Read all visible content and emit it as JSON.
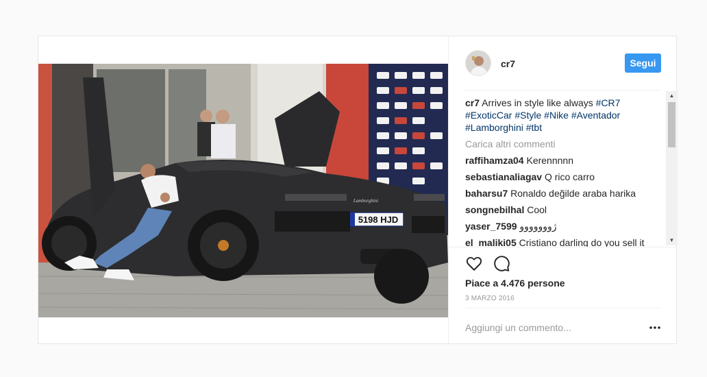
{
  "post": {
    "username": "cr7",
    "follow_label": "Segui",
    "caption": {
      "username": "cr7",
      "text_before": "Arrives in style like always",
      "hashtags": [
        "#CR7",
        "#ExoticCar",
        "#Style",
        "#Nike",
        "#Aventador",
        "#Lamborghini",
        "#tbt"
      ]
    },
    "load_more_label": "Carica altri commenti",
    "comments": [
      {
        "user": "raffihamza04",
        "text": "Kerennnnn"
      },
      {
        "user": "sebastianaliagav",
        "text": "Q rico carro"
      },
      {
        "user": "baharsu7",
        "text": "Ronaldo değilde araba harika"
      },
      {
        "user": "songnebilhal",
        "text": "Cool"
      },
      {
        "user": "yaser_7599",
        "text": "ژووووووو"
      },
      {
        "user": "el_maliki05",
        "text": "Cristiano darling do you sell it"
      }
    ],
    "likes_text": "Piace a 4.476 persone",
    "date": "3 MARZO 2016",
    "comment_placeholder": "Aggiungi un commento...",
    "photo": {
      "license_plate": "5198 HJD",
      "car_brand_badge": "Lamborghini"
    }
  },
  "icons": {
    "like": "heart-icon",
    "comment": "comment-bubble-icon",
    "more": "more-options-icon",
    "scroll_up": "scroll-up-arrow-icon",
    "scroll_down": "scroll-down-arrow-icon"
  },
  "colors": {
    "follow_button": "#3897f0",
    "hashtag": "#003569",
    "muted_text": "#999999"
  }
}
